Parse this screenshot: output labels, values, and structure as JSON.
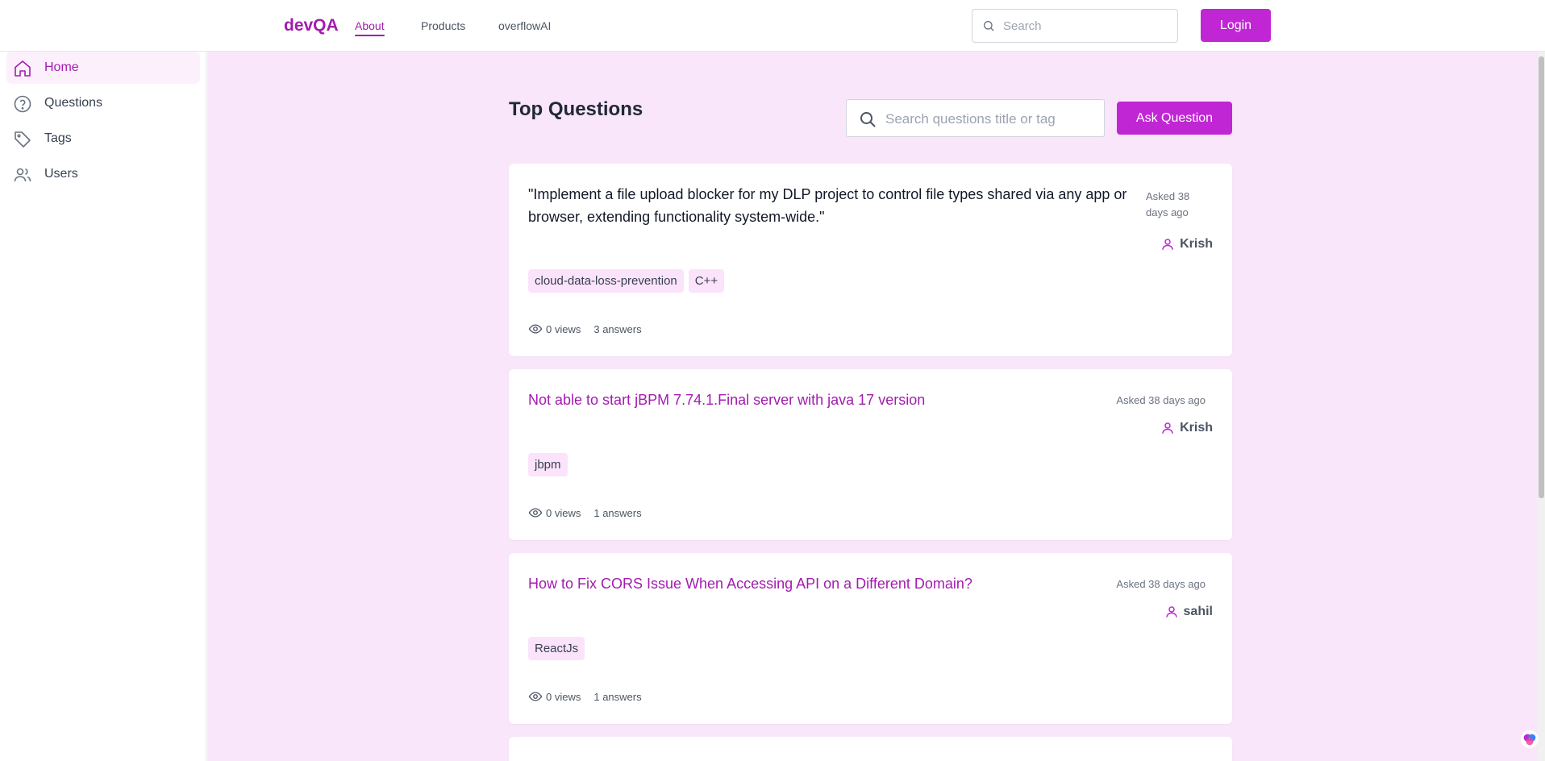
{
  "header": {
    "brand": "devQA",
    "nav": [
      {
        "label": "About"
      },
      {
        "label": "Products"
      },
      {
        "label": "overflowAI"
      }
    ],
    "search_placeholder": "Search",
    "login_label": "Login"
  },
  "sidebar": {
    "items": [
      {
        "label": "Home",
        "icon": "home-icon"
      },
      {
        "label": "Questions",
        "icon": "question-circle-icon"
      },
      {
        "label": "Tags",
        "icon": "tag-icon"
      },
      {
        "label": "Users",
        "icon": "users-icon"
      }
    ]
  },
  "main": {
    "title": "Top Questions",
    "search_placeholder": "Search questions title or tag",
    "ask_label": "Ask Question",
    "questions": [
      {
        "title": "\"Implement a file upload blocker for my DLP project to control file types shared via any app or browser, extending functionality system-wide.\"",
        "asked": "Asked 38 days ago",
        "author": "Krish",
        "tags": [
          "cloud-data-loss-prevention",
          "C++"
        ],
        "views": "0 views",
        "answers": "3 answers"
      },
      {
        "title": "Not able to start jBPM 7.74.1.Final server with java 17 version",
        "asked": "Asked 38 days ago",
        "author": "Krish",
        "tags": [
          "jbpm"
        ],
        "views": "0 views",
        "answers": "1 answers"
      },
      {
        "title": "How to Fix CORS Issue When Accessing API on a Different Domain?",
        "asked": "Asked 38 days ago",
        "author": "sahil",
        "tags": [
          "ReactJs"
        ],
        "views": "0 views",
        "answers": "1 answers"
      }
    ]
  },
  "colors": {
    "accent": "#c026d3",
    "accent_text": "#a21caf",
    "main_bg": "#f9e6fb",
    "tag_bg": "#fae3fb"
  }
}
